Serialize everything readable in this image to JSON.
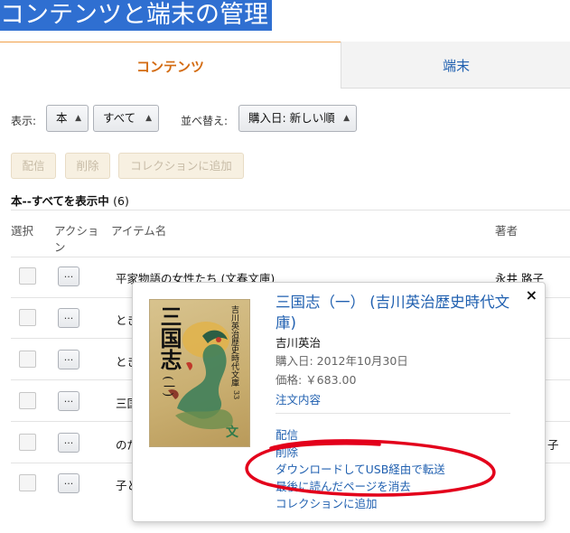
{
  "page_title": "コンテンツと端末の管理",
  "tabs": [
    {
      "label": "コンテンツ",
      "active": true
    },
    {
      "label": "端末",
      "active": false
    }
  ],
  "filters": {
    "show_label": "表示:",
    "type_value": "本",
    "scope_value": "すべて",
    "sort_label": "並べ替え:",
    "sort_value": "購入日: 新しい順"
  },
  "actions": {
    "deliver": "配信",
    "delete": "削除",
    "add_collection": "コレクションに追加"
  },
  "count_line": {
    "prefix": "本--すべてを表示中",
    "count": "(6)"
  },
  "table": {
    "col_select": "選択",
    "col_action": "アクショ\nン",
    "col_item": "アイテム名",
    "col_author": "著者",
    "action_button": "...",
    "rows": [
      {
        "title": "平家物語の女性たち (文春文庫)",
        "author": "永井 路子"
      },
      {
        "title": "とき",
        "author": ""
      },
      {
        "title": "とき",
        "author": ""
      },
      {
        "title": "三国",
        "author": ""
      },
      {
        "title": "のだ",
        "author": "子"
      },
      {
        "title": "子と",
        "author": ""
      }
    ]
  },
  "popover": {
    "close": "×",
    "title": "三国志（一） (吉川英治歴史時代文庫)",
    "author": "吉川英治",
    "purchase_date": "購入日: 2012年10月30日",
    "price": "価格: ￥683.00",
    "order_details": "注文内容",
    "menu": [
      "配信",
      "削除",
      "ダウンロードしてUSB経由で転送",
      "最後に読んだページを消去",
      "コレクションに追加"
    ],
    "cover": {
      "main_title": "三国志",
      "volume": "(一)",
      "series": "吉川英治歴史時代文庫",
      "number": "33",
      "publisher_mark": "文"
    }
  },
  "colors": {
    "accent_orange": "#d36b11",
    "link_blue": "#2060b0",
    "annotation_red": "#e3001b",
    "title_highlight": "#2f6fd1"
  }
}
